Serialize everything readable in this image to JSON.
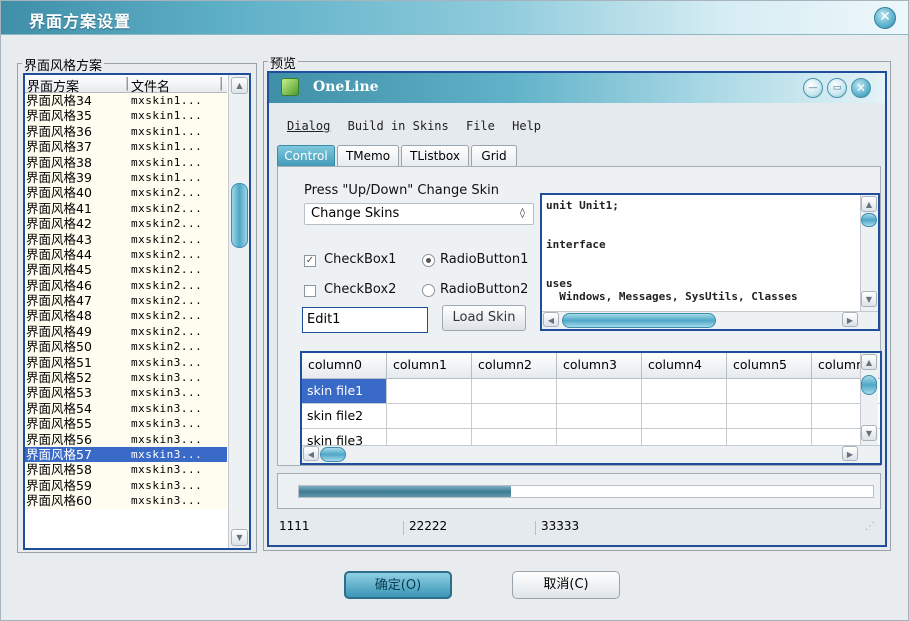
{
  "window": {
    "title": "界面方案设置"
  },
  "left_group": {
    "label": "界面风格方案",
    "columns": [
      "界面方案",
      "文件名"
    ],
    "rows": [
      [
        "界面风格34",
        "mxskin1..."
      ],
      [
        "界面风格35",
        "mxskin1..."
      ],
      [
        "界面风格36",
        "mxskin1..."
      ],
      [
        "界面风格37",
        "mxskin1..."
      ],
      [
        "界面风格38",
        "mxskin1..."
      ],
      [
        "界面风格39",
        "mxskin1..."
      ],
      [
        "界面风格40",
        "mxskin2..."
      ],
      [
        "界面风格41",
        "mxskin2..."
      ],
      [
        "界面风格42",
        "mxskin2..."
      ],
      [
        "界面风格43",
        "mxskin2..."
      ],
      [
        "界面风格44",
        "mxskin2..."
      ],
      [
        "界面风格45",
        "mxskin2..."
      ],
      [
        "界面风格46",
        "mxskin2..."
      ],
      [
        "界面风格47",
        "mxskin2..."
      ],
      [
        "界面风格48",
        "mxskin2..."
      ],
      [
        "界面风格49",
        "mxskin2..."
      ],
      [
        "界面风格50",
        "mxskin2..."
      ],
      [
        "界面风格51",
        "mxskin3..."
      ],
      [
        "界面风格52",
        "mxskin3..."
      ],
      [
        "界面风格53",
        "mxskin3..."
      ],
      [
        "界面风格54",
        "mxskin3..."
      ],
      [
        "界面风格55",
        "mxskin3..."
      ],
      [
        "界面风格56",
        "mxskin3..."
      ],
      [
        "界面风格57",
        "mxskin3..."
      ],
      [
        "界面风格58",
        "mxskin3..."
      ],
      [
        "界面风格59",
        "mxskin3..."
      ],
      [
        "界面风格60",
        "mxskin3..."
      ]
    ],
    "selected_row": "界面风格57"
  },
  "preview_group": {
    "label": "预览",
    "window_title": "OneLine",
    "menu": [
      "Dialog",
      "Build in Skins",
      "File",
      "Help"
    ],
    "tabs": [
      "Control",
      "TMemo",
      "TListbox",
      "Grid"
    ],
    "active_tab": "Control",
    "skin_label": "Press \"Up/Down\" Change Skin",
    "combo_value": "Change Skins",
    "checkbox1": {
      "label": "CheckBox1",
      "checked": true
    },
    "checkbox2": {
      "label": "CheckBox2",
      "checked": false
    },
    "radio1": {
      "label": "RadioButton1",
      "checked": true
    },
    "radio2": {
      "label": "RadioButton2",
      "checked": false
    },
    "edit_value": "Edit1",
    "load_button": "Load Skin",
    "memo_text": "unit Unit1;\n\n\ninterface\n\n\nuses\n  Windows, Messages, SysUtils, Classes",
    "grid": {
      "columns": [
        "column0",
        "column1",
        "column2",
        "column3",
        "column4",
        "column5",
        "columr"
      ],
      "rows": [
        "skin file1",
        "skin file2",
        "skin file3"
      ],
      "selected": "skin file1"
    },
    "progress": 0.37,
    "status": [
      "1111",
      "22222",
      "33333"
    ]
  },
  "footer": {
    "ok": "确定(O)",
    "cancel": "取消(C)"
  },
  "colors": {
    "accent": "#3f98b6",
    "selection": "#3a6ac8",
    "border_focus": "#1f4f9a"
  }
}
